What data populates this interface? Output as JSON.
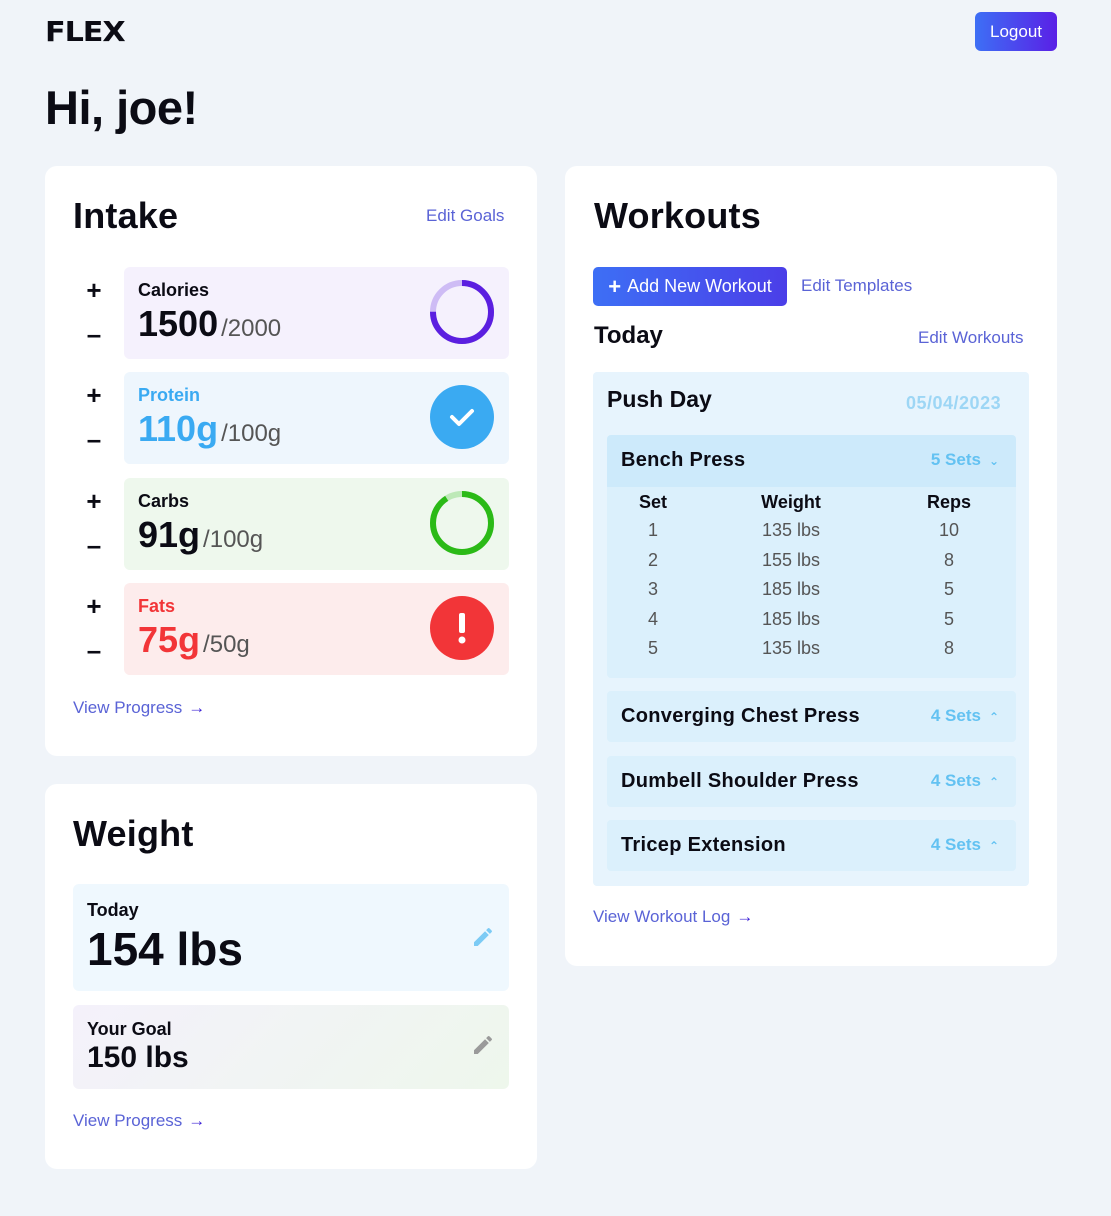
{
  "app": {
    "logo": "FLEX",
    "logout_label": "Logout"
  },
  "greeting": "Hi, joe!",
  "intake": {
    "title": "Intake",
    "edit_goals": "Edit Goals",
    "plus": "+",
    "minus": "–",
    "macros": [
      {
        "label": "Calories",
        "value": "1500",
        "goal": "/2000",
        "progress": 0.75,
        "status": "in-progress",
        "color": "#5b1fe0",
        "bg": "#f5f1fd",
        "text_color": "#0b0b14"
      },
      {
        "label": "Protein",
        "value": "110g",
        "goal": "/100g",
        "progress": 1.1,
        "status": "complete",
        "color": "#3aaaf2",
        "bg": "#eef6fd",
        "text_color": "#3aaaf2"
      },
      {
        "label": "Carbs",
        "value": "91g",
        "goal": "/100g",
        "progress": 0.91,
        "status": "in-progress",
        "color": "#2bba17",
        "bg": "#eef8ed",
        "text_color": "#0b0b14"
      },
      {
        "label": "Fats",
        "value": "75g",
        "goal": "/50g",
        "progress": 1.5,
        "status": "over",
        "color": "#f23538",
        "bg": "#fdecec",
        "text_color": "#f23538"
      }
    ],
    "view_progress": "View Progress"
  },
  "weight": {
    "title": "Weight",
    "today_label": "Today",
    "today_value": "154 lbs",
    "goal_label": "Your Goal",
    "goal_value": "150 lbs",
    "view_progress": "View Progress"
  },
  "workouts": {
    "title": "Workouts",
    "add_label": "Add New Workout",
    "edit_templates": "Edit Templates",
    "today_label": "Today",
    "edit_workouts": "Edit Workouts",
    "session_name": "Push Day",
    "session_date": "05/04/2023",
    "columns": [
      "Set",
      "Weight",
      "Reps"
    ],
    "exercises": [
      {
        "name": "Bench Press",
        "sets_label": "5 Sets",
        "expanded": true,
        "sets": [
          [
            "1",
            "135 lbs",
            "10"
          ],
          [
            "2",
            "155 lbs",
            "8"
          ],
          [
            "3",
            "185 lbs",
            "5"
          ],
          [
            "4",
            "185 lbs",
            "5"
          ],
          [
            "5",
            "135 lbs",
            "8"
          ]
        ]
      },
      {
        "name": "Converging Chest Press",
        "sets_label": "4 Sets",
        "expanded": false
      },
      {
        "name": "Dumbell Shoulder Press",
        "sets_label": "4 Sets",
        "expanded": false
      },
      {
        "name": "Tricep Extension",
        "sets_label": "4 Sets",
        "expanded": false
      }
    ],
    "view_log": "View Workout Log"
  },
  "icons": {
    "plus": "plus-icon",
    "minus": "minus-icon",
    "check": "check-icon",
    "alert": "exclamation-icon",
    "pencil": "pencil-icon",
    "arrow": "arrow-right-icon",
    "chevron_down": "chevron-down-icon",
    "chevron_up": "chevron-up-icon"
  }
}
